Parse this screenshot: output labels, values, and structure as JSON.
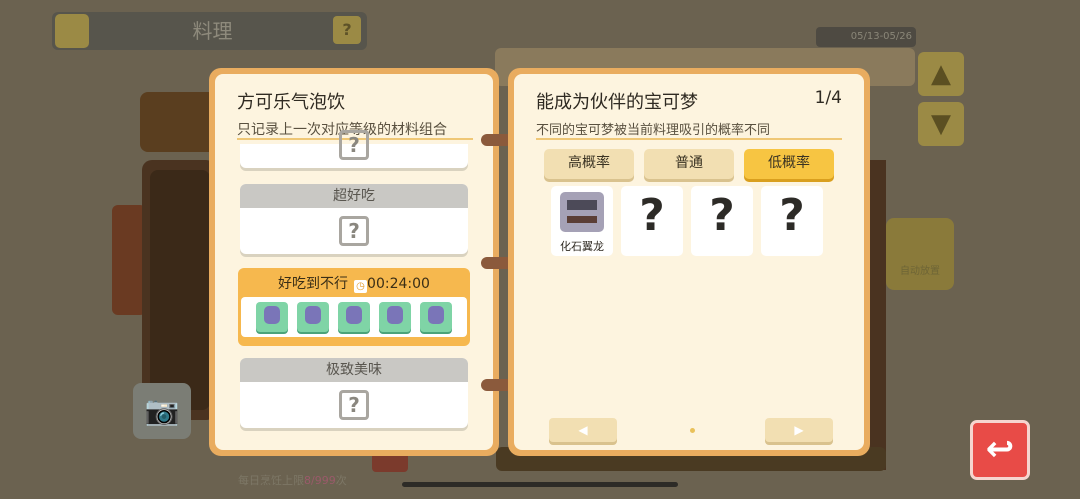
{
  "background": {
    "title": "料理",
    "help_icon": "?",
    "date_range": "05/13-05/26",
    "header_text": "方可乐气泡饮",
    "auto_place_label": "自动放置",
    "daily_limit_prefix": "每日烹饪上限",
    "daily_limit_value": "8/999",
    "daily_limit_suffix": "次"
  },
  "left_page": {
    "title": "方可乐气泡饮",
    "subtitle": "只记录上一次对应等级的材料组合",
    "recipes": [
      {
        "label": "超好吃",
        "state": "unknown"
      },
      {
        "label": "好吃到不行",
        "state": "active",
        "timer": "00:24:00",
        "ingredient_count": 5
      },
      {
        "label": "极致美味",
        "state": "unknown"
      }
    ]
  },
  "right_page": {
    "title": "能成为伙伴的宝可梦",
    "page_indicator": "1/4",
    "subtitle": "不同的宝可梦被当前料理吸引的概率不同",
    "tabs": [
      {
        "label": "高概率",
        "selected": false
      },
      {
        "label": "普通",
        "selected": false
      },
      {
        "label": "低概率",
        "selected": true
      }
    ],
    "pokemon_slots": [
      {
        "name": "化石翼龙",
        "known": true
      },
      {
        "name": "?",
        "known": false
      },
      {
        "name": "?",
        "known": false
      },
      {
        "name": "?",
        "known": false
      }
    ],
    "prev_label": "◀",
    "next_label": "▶"
  },
  "colors": {
    "book_border": "#e9ac5f",
    "page_bg": "#fdf4df",
    "tab_selected": "#f7c542",
    "back_button": "#e84b47"
  }
}
